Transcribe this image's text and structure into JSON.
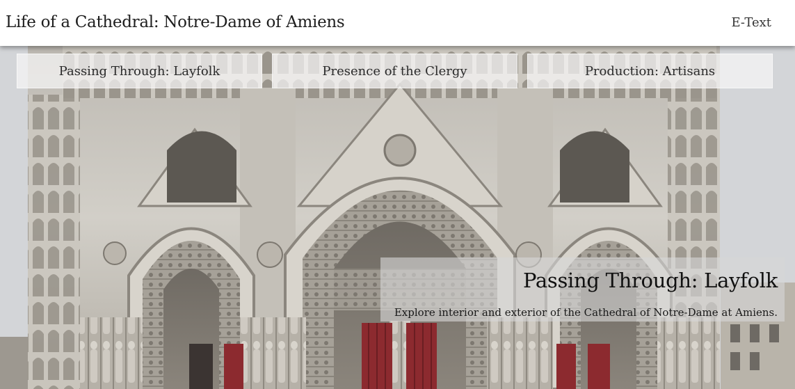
{
  "header": {
    "site_title": "Life of a Cathedral: Notre-Dame of Amiens",
    "etext_label": "E-Text"
  },
  "nav": {
    "tabs": [
      {
        "label": "Passing Through: Layfolk"
      },
      {
        "label": "Presence of the Clergy"
      },
      {
        "label": "Production: Artisans"
      }
    ]
  },
  "hero": {
    "image_subject": "cathedral-facade",
    "caption_title": "Passing Through: Layfolk",
    "caption_subtitle": "Explore interior and exterior of the Cathedral of Notre-Dame at Amiens."
  },
  "colors": {
    "stone": "#c9c6bf",
    "stone_dark": "#8e8a82",
    "door_red": "#8c2a2f",
    "sky": "#c9ccd1"
  }
}
